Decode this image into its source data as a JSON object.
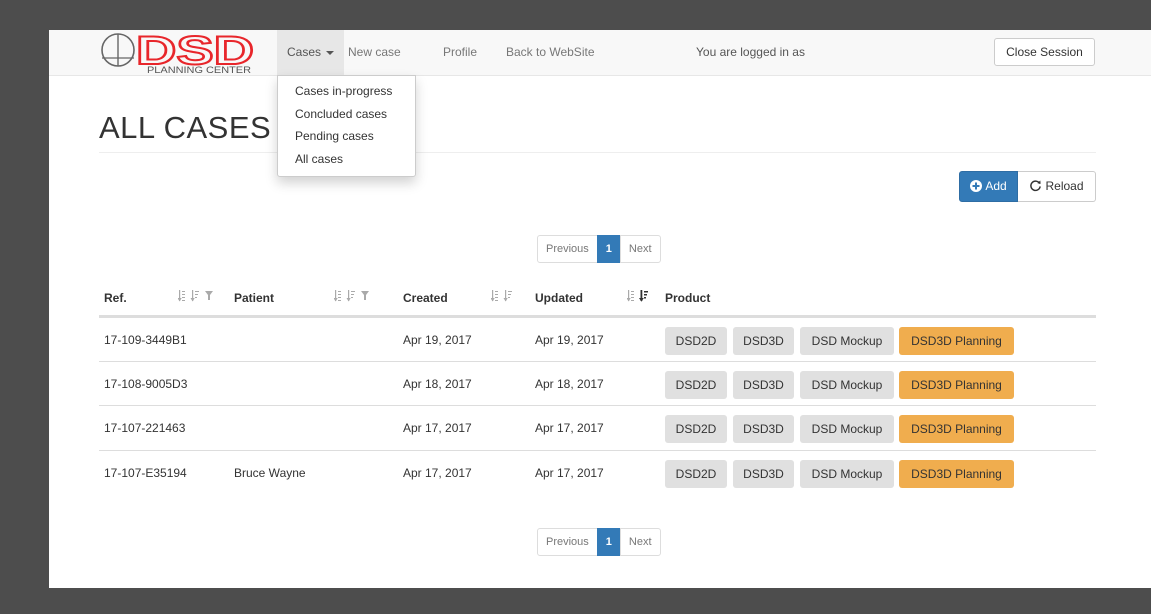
{
  "navbar": {
    "logo_text": "DSD",
    "logo_subtext": "PLANNING CENTER",
    "items": [
      {
        "label": "Cases",
        "active": true
      },
      {
        "label": "New case"
      },
      {
        "label": "Profile"
      },
      {
        "label": "Back to WebSite"
      }
    ],
    "logged_in_text": "You are logged in as",
    "close_session_label": "Close Session"
  },
  "dropdown": {
    "items": [
      "Cases in-progress",
      "Concluded cases",
      "Pending cases",
      "All cases"
    ]
  },
  "page": {
    "title": "ALL CASES"
  },
  "toolbar": {
    "add_label": "Add",
    "reload_label": "Reload"
  },
  "pagination": {
    "previous_label": "Previous",
    "current_page": "1",
    "next_label": "Next"
  },
  "table": {
    "columns": [
      "Ref.",
      "Patient",
      "Created",
      "Updated",
      "Product"
    ],
    "rows": [
      {
        "ref": "17-109-3449B1",
        "patient": "",
        "created": "Apr 19, 2017",
        "updated": "Apr 19, 2017"
      },
      {
        "ref": "17-108-9005D3",
        "patient": "",
        "created": "Apr 18, 2017",
        "updated": "Apr 18, 2017"
      },
      {
        "ref": "17-107-221463",
        "patient": "",
        "created": "Apr 17, 2017",
        "updated": "Apr 17, 2017"
      },
      {
        "ref": "17-107-E35194",
        "patient": "Bruce Wayne",
        "created": "Apr 17, 2017",
        "updated": "Apr 17, 2017"
      }
    ],
    "products": [
      "DSD2D",
      "DSD3D",
      "DSD Mockup",
      "DSD3D Planning"
    ]
  },
  "colors": {
    "brand_red": "#e8262b",
    "primary_blue": "#337ab7",
    "planning_orange": "#f0ad4e",
    "product_gray": "#e0e0e0"
  }
}
